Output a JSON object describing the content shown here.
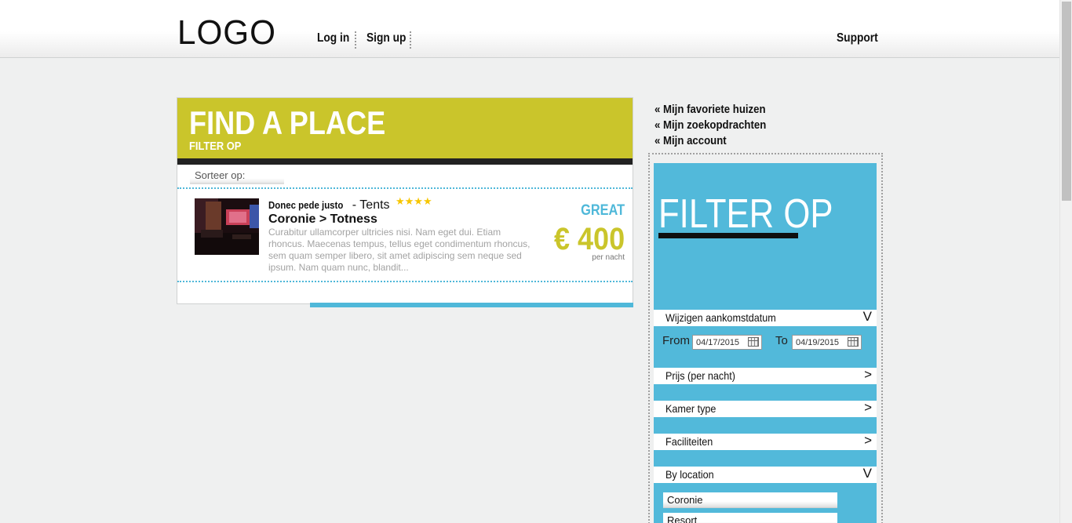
{
  "header": {
    "logo": "LOGO",
    "login_label": "Log in",
    "signup_label": "Sign up",
    "support_label": "Support"
  },
  "main": {
    "title": "FIND A PLACE",
    "subtitle": "FILTER OP",
    "sort_label": "Sorteer op:",
    "listing": {
      "name": "Donec pede justo",
      "type": " - Tents",
      "stars": "★★★★",
      "location": "Coronie > Totness",
      "description": "Curabitur ullamcorper ultricies nisi. Nam eget dui. Etiam rhoncus. Maecenas tempus, tellus eget condimentum rhoncus, sem quam semper libero, sit amet adipiscing sem neque sed ipsum. Nam quam nunc, blandit...",
      "rating": "GREAT",
      "price": "€ 400",
      "price_unit": "per nacht",
      "star_count": 4
    }
  },
  "side_links": [
    "« Mijn favoriete huizen",
    "« Mijn zoekopdrachten",
    "« Mijn account"
  ],
  "filter": {
    "title": "FILTER OP",
    "arrival_label": "Wijzigen aankomstdatum",
    "arrival_chevron": "V",
    "from_label": "From",
    "from_value": "04/17/2015",
    "to_label": "To",
    "to_value": "04/19/2015",
    "price_label": "Prijs (per nacht)",
    "room_label": "Kamer type",
    "facilities_label": "Faciliteiten",
    "collapsed_chevron": ">",
    "location_label": "By location",
    "location_chevron": "V",
    "location_options": [
      "Coronie",
      "Resort"
    ]
  },
  "colors": {
    "accent_yellow": "#cac52b",
    "accent_blue": "#52b9da",
    "background": "#eff0f0"
  }
}
